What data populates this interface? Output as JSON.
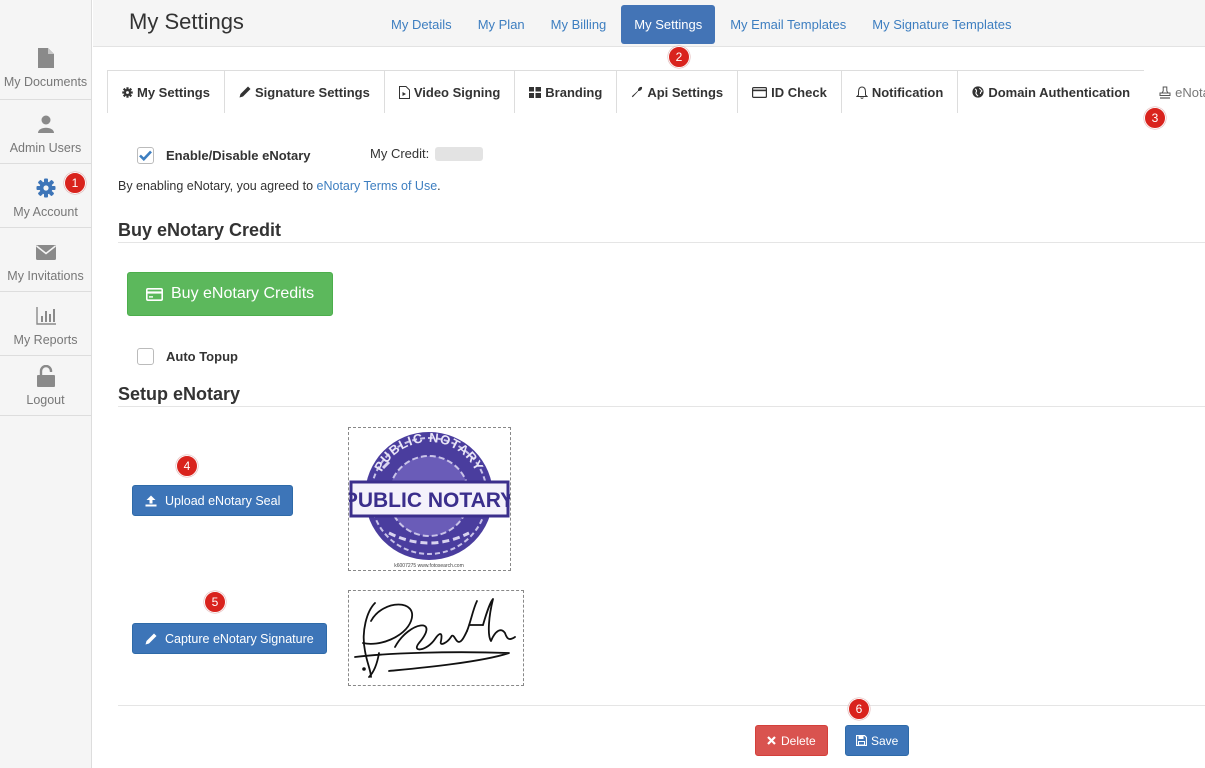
{
  "sidebar": {
    "items": [
      {
        "label": "My Documents",
        "icon": "document-icon"
      },
      {
        "label": "Admin Users",
        "icon": "user-icon"
      },
      {
        "label": "My Account",
        "icon": "gear-icon"
      },
      {
        "label": "My Invitations",
        "icon": "envelope-icon"
      },
      {
        "label": "My Reports",
        "icon": "bar-chart-icon"
      },
      {
        "label": "Logout",
        "icon": "unlock-icon"
      }
    ]
  },
  "header": {
    "title": "My Settings",
    "nav": [
      "My Details",
      "My Plan",
      "My Billing",
      "My Settings",
      "My Email Templates",
      "My Signature Templates"
    ],
    "active_nav": "My Settings"
  },
  "tabs": [
    {
      "label": "My Settings",
      "icon": "gear-icon"
    },
    {
      "label": "Signature Settings",
      "icon": "pencil-icon"
    },
    {
      "label": "Video Signing",
      "icon": "video-file-icon"
    },
    {
      "label": "Branding",
      "icon": "grid-icon"
    },
    {
      "label": "Api Settings",
      "icon": "wrench-icon"
    },
    {
      "label": "ID Check",
      "icon": "id-card-icon"
    },
    {
      "label": "Notification",
      "icon": "bell-icon"
    },
    {
      "label": "Domain Authentication",
      "icon": "globe-icon"
    },
    {
      "label": "eNotary",
      "icon": "stamp-icon"
    }
  ],
  "enotary": {
    "enable_label": "Enable/Disable eNotary",
    "enabled": true,
    "credit_label": "My Credit:",
    "terms_prefix": "By enabling eNotary, you agreed to ",
    "terms_link": "eNotary Terms of Use",
    "terms_suffix": "."
  },
  "buy_section": {
    "heading": "Buy eNotary Credit",
    "button": "Buy eNotary Credits",
    "auto_topup_label": "Auto Topup",
    "auto_topup": false
  },
  "setup_section": {
    "heading": "Setup eNotary",
    "upload_seal_button": "Upload eNotary Seal",
    "capture_signature_button": "Capture eNotary Signature",
    "seal_text_top": "PUBLIC NOTARY",
    "seal_text_center": "PUBLIC NOTARY",
    "seal_caption": "k6007275 www.fotosearch.com"
  },
  "actions": {
    "delete": "Delete",
    "save": "Save"
  },
  "badges": [
    "1",
    "2",
    "3",
    "4",
    "5",
    "6"
  ],
  "colors": {
    "primary": "#3d75b8",
    "success": "#5cb85c",
    "danger": "#d9534f",
    "badge": "#d9231d",
    "link": "#3d7ec0"
  }
}
